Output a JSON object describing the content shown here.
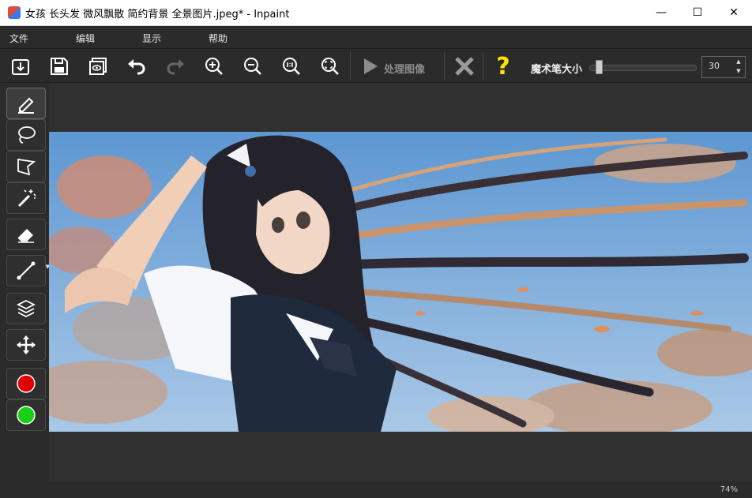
{
  "window": {
    "title": "女孩 长头发 微风飘散 简约背景 全景图片.jpeg* - Inpaint",
    "controls": {
      "minimize": "—",
      "maximize": "☐",
      "close": "✕"
    }
  },
  "menu": [
    "文件",
    "编辑",
    "显示",
    "帮助"
  ],
  "toolbar": {
    "process_label": "处理图像",
    "brush_size_label": "魔术笔大小",
    "brush_size_value": "30",
    "brush_size_level": 0.05,
    "help_glyph": "?"
  },
  "colors": {
    "marker_red": "#e00000",
    "marker_green": "#18d018",
    "help_yellow": "#ffe000",
    "background": "#2b2b2b"
  },
  "status": {
    "zoom": "74%"
  }
}
